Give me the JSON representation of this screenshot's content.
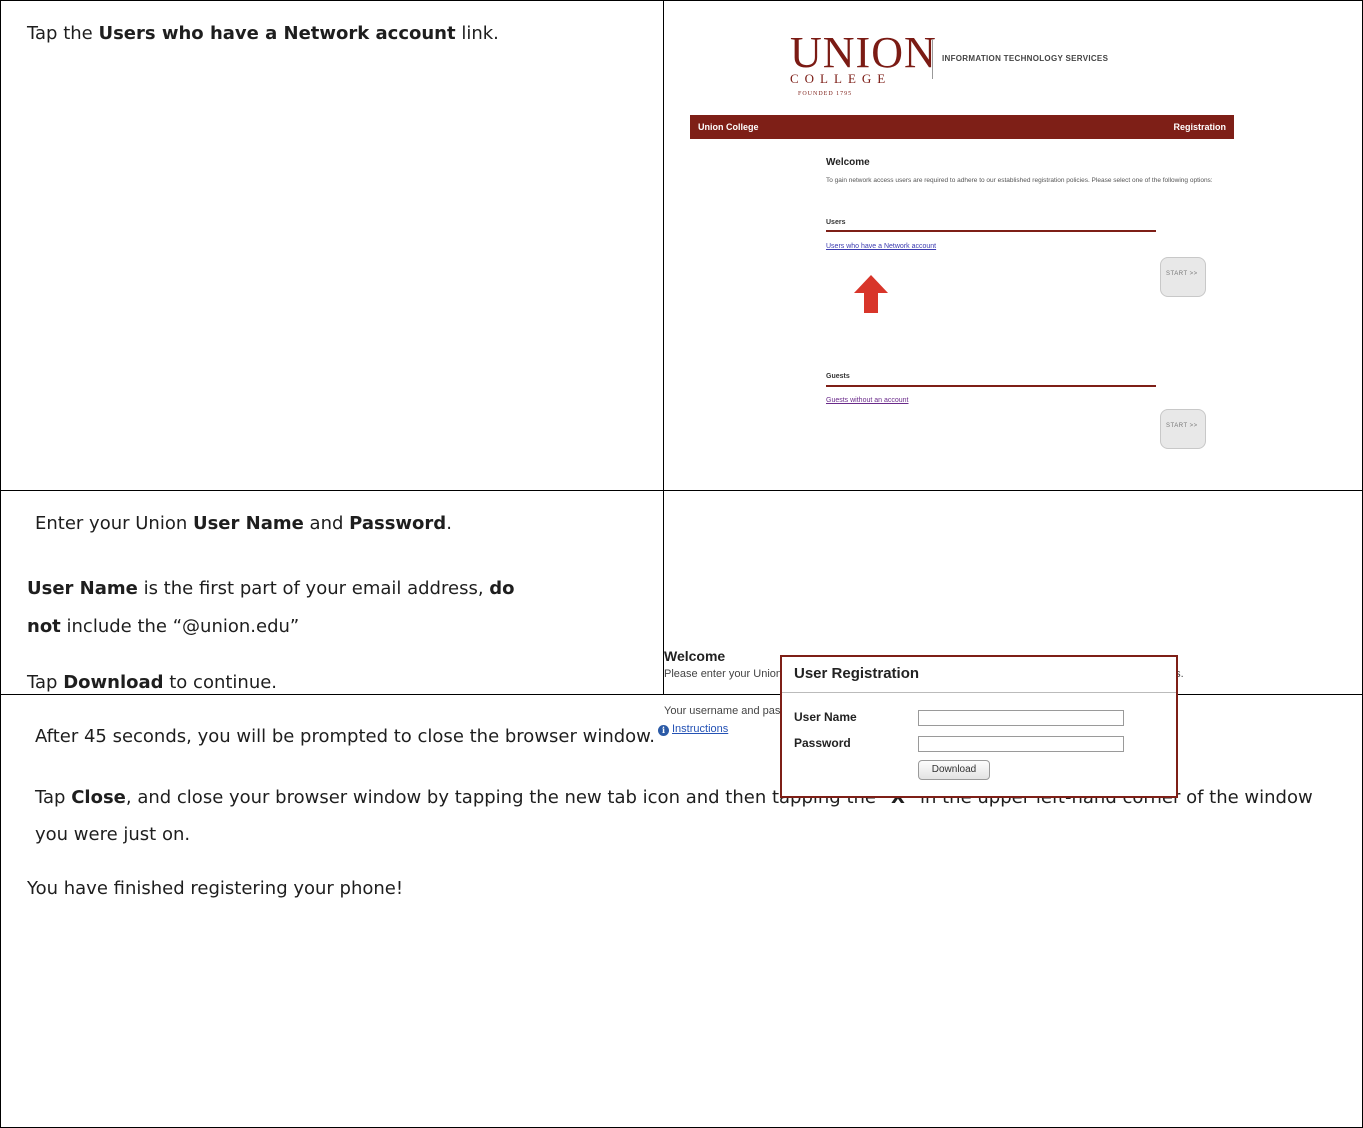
{
  "step1": {
    "text_before": "Tap the ",
    "text_bold": "Users who have a Network account",
    "text_after": " link.",
    "screenshot": {
      "logo_union": "UNION",
      "logo_college": "COLLEGE",
      "logo_founded": "FOUNDED 1795",
      "logo_its": "INFORMATION TECHNOLOGY SERVICES",
      "bar_left": "Union College",
      "bar_right": "Registration",
      "welcome": "Welcome",
      "description": "To gain network access users are required to adhere to our established registration policies. Please select one of the following options:",
      "users_heading": "Users",
      "users_link": "Users who have a Network account",
      "start_label": "START >>",
      "guests_heading": "Guests",
      "guests_link": "Guests without an account",
      "arrow_color": "#d8352a"
    }
  },
  "step2": {
    "line1_before": "Enter your Union ",
    "line1_bold1": "User Name",
    "line1_mid": " and ",
    "line1_bold2": "Password",
    "line1_after": ".",
    "line2_bold1": "User Name",
    "line2_mid": " is the first part of your email address, ",
    "line2_bold2": "do",
    "line2_bold3": "not",
    "line2_after": " include the “@union.edu”",
    "line3_before": "Tap ",
    "line3_bold": "Download",
    "line3_after": " to continue.",
    "screenshot": {
      "welcome": "Welcome",
      "line1": "Please enter your Union College Network username and password below to begin the registration process.",
      "line2": "Your username and password are the same as your Union e-mail username and password.",
      "instructions_link": "Instructions",
      "info_icon_glyph": "i",
      "box_title": "User Registration",
      "user_name_label": "User Name",
      "password_label": "Password",
      "download_button": "Download"
    }
  },
  "step3": {
    "line1": "After 45 seconds, you will be prompted to close the browser window.",
    "line2_before": "Tap ",
    "line2_bold": "Close",
    "line2_mid": ", and close your browser window by tapping the new tab icon and then tapping the “",
    "line2_bold2": "X",
    "line2_after": "” in the upper left-hand corner of the window you were just on.",
    "line3": "You have finished registering your phone!"
  },
  "colors": {
    "brand_maroon": "#7e1f17",
    "link_blue": "#2452b5"
  }
}
